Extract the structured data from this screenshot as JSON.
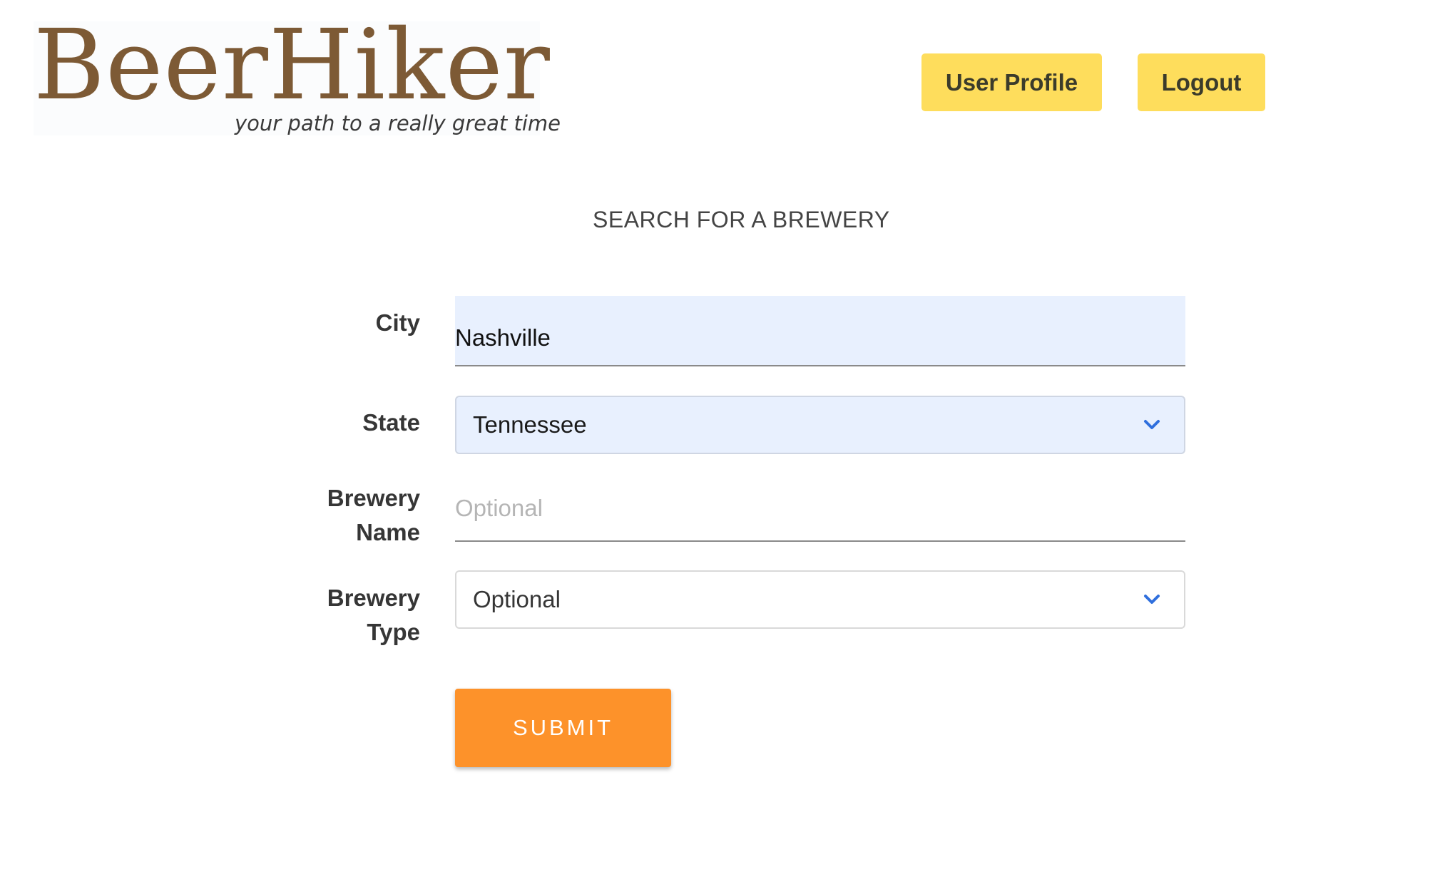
{
  "header": {
    "logo": {
      "wordmark": "BeerHiker",
      "tagline": "your path to a really great time",
      "color": "#7d5a35"
    },
    "profile_button_label": "User Profile",
    "logout_button_label": "Logout",
    "button_color": "#fedd5c"
  },
  "search": {
    "heading": "SEARCH FOR A BREWERY",
    "city": {
      "label": "City",
      "value": "Nashville"
    },
    "state": {
      "label": "State",
      "selected": "Tennessee",
      "icon": "chevron-down-icon"
    },
    "brewery_name": {
      "label_line1": "Brewery",
      "label_line2": "Name",
      "placeholder": "Optional",
      "value": ""
    },
    "brewery_type": {
      "label_line1": "Brewery",
      "label_line2": "Type",
      "selected": "Optional",
      "icon": "chevron-down-icon"
    },
    "submit_label": "SUBMIT",
    "submit_color": "#fd922a",
    "autofill_color": "#e8f0fe",
    "chevron_color": "#2f6fdd"
  }
}
